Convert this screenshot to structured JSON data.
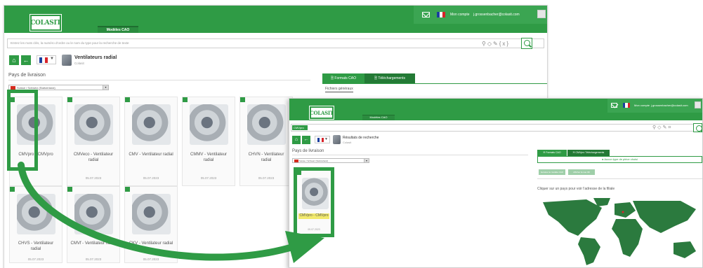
{
  "main": {
    "logo_text": "COLASIT",
    "nav_tab": "Modèles CAO",
    "account_label": "Mon compte",
    "user_email": "j.grossenbacher@colasit.com",
    "search_placeholder": "Entrez les mots clés, la numéro d'ordre ou le nom du type pour la recherche de texte",
    "product_title": "Ventilateurs radial",
    "product_sub": "Colasit",
    "delivery_label": "Pays de livraison",
    "country_value": "Suisse / Schweiz (Switzerland)",
    "tab_formats": "Formats CAO",
    "tab_downloads": "Téléchargements",
    "general_files": "Fichiers généraux",
    "cards": [
      {
        "label": "CMVpro - CMVpro",
        "date": ""
      },
      {
        "label": "CMVeco - Ventilateur radial",
        "date": "05.07.2023"
      },
      {
        "label": "CMV - Ventilateur radial",
        "date": "05.07.2023"
      },
      {
        "label": "CMMV - Ventilateur radial",
        "date": "05.07.2023"
      },
      {
        "label": "CHVN - Ventilateur radial",
        "date": "05.07.2023"
      },
      {
        "label": "CHVS - Ventilateur radial",
        "date": "05.07.2023"
      },
      {
        "label": "CMVf - Ventilateur radial",
        "date": "05.07.2023"
      },
      {
        "label": "CKV - Ventilateur radial",
        "date": "05.07.2023"
      }
    ]
  },
  "front": {
    "logo_text": "COLASIT",
    "nav_tab": "Modèles CAO",
    "account_label": "Mon compte",
    "user_email": "j.grossenbacher@colasit.com",
    "search_value": "CMVpro",
    "results_title": "Résultats de recherche",
    "results_sub": "Colasit",
    "delivery_label": "Pays de livraison",
    "country_value": "Suisse / Schweiz (Switzerland)",
    "card_label": "CMVpro - CMVpro",
    "card_date": "05.07.2023",
    "tab_formats": "Formats CAO",
    "tab_downloads": "CMVpro Téléchargements",
    "choose_label": "Aucun type de pièce choisi",
    "btn_generate": "Générer le modèle CAO",
    "btn_preview": "Afficher la vue 3D",
    "map_caption": "Cliquer sur un pays pour voir l'adresse de la filiale"
  },
  "colors": {
    "brand_green": "#2f9b45",
    "dark_green": "#237a35",
    "map_land": "#2b7a3e"
  }
}
